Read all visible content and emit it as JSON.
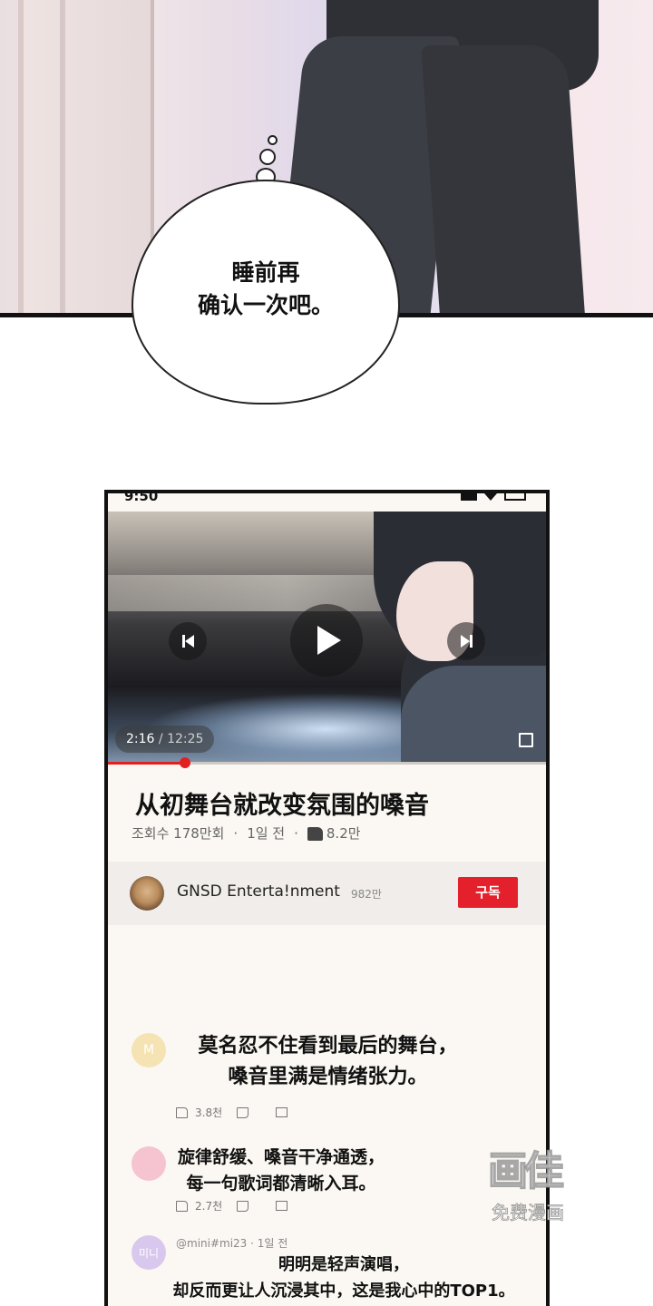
{
  "panel": {
    "thought_text_line1": "睡前再",
    "thought_text_line2": "确认一次吧。"
  },
  "phone": {
    "status_time": "9:50",
    "video": {
      "current_time": "2:16",
      "separator": " / ",
      "duration": "12:25",
      "progress_fraction": 0.176
    },
    "title": "从初舞台就改变氛围的嗓音",
    "meta": {
      "views": "조회수 178만회",
      "dot1": "·",
      "age": "1일 전",
      "dot2": "·",
      "likes": "8.2만"
    },
    "channel": {
      "name": "GNSD Enterta!nment",
      "subscribers": "982만",
      "subscribe_label": "구독"
    },
    "comments": [
      {
        "avatar_letter": "M",
        "avatar_color": "#f6e3b3",
        "line1": "莫名忍不住看到最后的舞台，",
        "line2": "嗓音里满是情绪张力。",
        "likes": "3.8천"
      },
      {
        "avatar_letter": "",
        "avatar_color": "#f6c3d0",
        "line1": "旋律舒缓、嗓音干净通透，",
        "line2": "每一句歌词都清晰入耳。",
        "likes": "2.7천"
      },
      {
        "avatar_letter": "미니",
        "avatar_color": "#d9c8ee",
        "author_meta": "@mini#mi23 · 1일 전",
        "line1": "明明是轻声演唱，",
        "line2": "却反而更让人沉浸其中，这是我心中的TOP1。"
      }
    ]
  },
  "watermark": {
    "logo": "画佳",
    "subtitle": "免费漫画"
  }
}
